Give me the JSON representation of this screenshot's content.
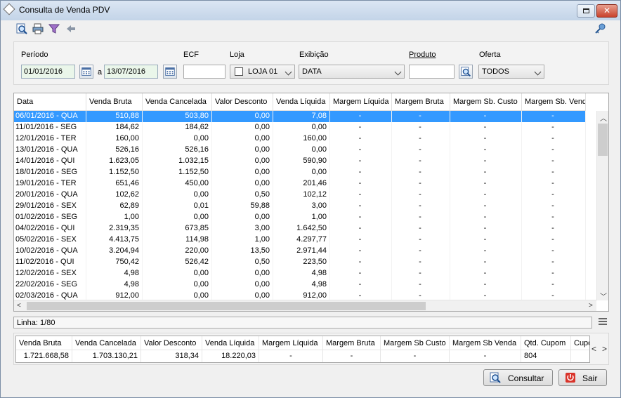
{
  "window": {
    "title": "Consulta de Venda PDV"
  },
  "toolbar": {
    "icons": [
      "preview-icon",
      "print-icon",
      "filter-icon",
      "back-arrow-icon",
      "key-icon"
    ]
  },
  "filters": {
    "periodo_label": "Período",
    "date_from": "01/01/2016",
    "a_label": "a",
    "date_to": "13/07/2016",
    "ecf_label": "ECF",
    "ecf_value": "",
    "loja_label": "Loja",
    "loja_value": "LOJA 01",
    "exibicao_label": "Exibição",
    "exibicao_value": "DATA",
    "produto_label": "Produto",
    "produto_value": "",
    "oferta_label": "Oferta",
    "oferta_value": "TODOS"
  },
  "grid": {
    "columns": [
      "Data",
      "Venda Bruta",
      "Venda Cancelada",
      "Valor Desconto",
      "Venda Líquida",
      "Margem Líquida",
      "Margem Bruta",
      "Margem Sb. Custo",
      "Margem Sb. Venda"
    ],
    "rows": [
      [
        "06/01/2016 - QUA",
        "510,88",
        "503,80",
        "0,00",
        "7,08",
        "-",
        "-",
        "-",
        "-"
      ],
      [
        "11/01/2016 - SEG",
        "184,62",
        "184,62",
        "0,00",
        "0,00",
        "-",
        "-",
        "-",
        "-"
      ],
      [
        "12/01/2016 - TER",
        "160,00",
        "0,00",
        "0,00",
        "160,00",
        "-",
        "-",
        "-",
        "-"
      ],
      [
        "13/01/2016 - QUA",
        "526,16",
        "526,16",
        "0,00",
        "0,00",
        "-",
        "-",
        "-",
        "-"
      ],
      [
        "14/01/2016 - QUI",
        "1.623,05",
        "1.032,15",
        "0,00",
        "590,90",
        "-",
        "-",
        "-",
        "-"
      ],
      [
        "18/01/2016 - SEG",
        "1.152,50",
        "1.152,50",
        "0,00",
        "0,00",
        "-",
        "-",
        "-",
        "-"
      ],
      [
        "19/01/2016 - TER",
        "651,46",
        "450,00",
        "0,00",
        "201,46",
        "-",
        "-",
        "-",
        "-"
      ],
      [
        "20/01/2016 - QUA",
        "102,62",
        "0,00",
        "0,50",
        "102,12",
        "-",
        "-",
        "-",
        "-"
      ],
      [
        "29/01/2016 - SEX",
        "62,89",
        "0,01",
        "59,88",
        "3,00",
        "-",
        "-",
        "-",
        "-"
      ],
      [
        "01/02/2016 - SEG",
        "1,00",
        "0,00",
        "0,00",
        "1,00",
        "-",
        "-",
        "-",
        "-"
      ],
      [
        "04/02/2016 - QUI",
        "2.319,35",
        "673,85",
        "3,00",
        "1.642,50",
        "-",
        "-",
        "-",
        "-"
      ],
      [
        "05/02/2016 - SEX",
        "4.413,75",
        "114,98",
        "1,00",
        "4.297,77",
        "-",
        "-",
        "-",
        "-"
      ],
      [
        "10/02/2016 - QUA",
        "3.204,94",
        "220,00",
        "13,50",
        "2.971,44",
        "-",
        "-",
        "-",
        "-"
      ],
      [
        "11/02/2016 - QUI",
        "750,42",
        "526,42",
        "0,50",
        "223,50",
        "-",
        "-",
        "-",
        "-"
      ],
      [
        "12/02/2016 - SEX",
        "4,98",
        "0,00",
        "0,00",
        "4,98",
        "-",
        "-",
        "-",
        "-"
      ],
      [
        "22/02/2016 - SEG",
        "4,98",
        "0,00",
        "0,00",
        "4,98",
        "-",
        "-",
        "-",
        "-"
      ],
      [
        "02/03/2016 - QUA",
        "912,00",
        "0,00",
        "0,00",
        "912,00",
        "-",
        "-",
        "-",
        "-"
      ]
    ]
  },
  "status": {
    "linha": "Linha: 1/80"
  },
  "totals": {
    "headers": [
      "Venda Bruta",
      "Venda Cancelada",
      "Valor Desconto",
      "Venda Líquida",
      "Margem Líquida",
      "Margem Bruta",
      "Margem Sb Custo",
      "Margem Sb Venda",
      "Qtd. Cupom",
      "Cupo"
    ],
    "values": [
      "1.721.668,58",
      "1.703.130,21",
      "318,34",
      "18.220,03",
      "-",
      "-",
      "-",
      "-",
      "804",
      ""
    ]
  },
  "buttons": {
    "consultar": "Consultar",
    "sair": "Sair"
  }
}
